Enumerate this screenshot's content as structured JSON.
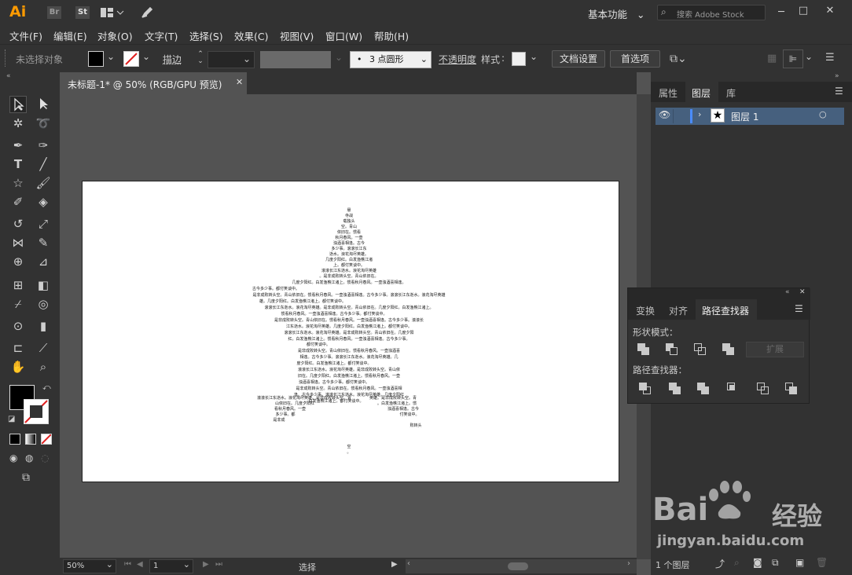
{
  "app": {
    "logo": "Ai",
    "br": "Br",
    "st": "St",
    "workspace": "基本功能",
    "search_placeholder": "搜索 Adobe Stock"
  },
  "menu": [
    "文件(F)",
    "编辑(E)",
    "对象(O)",
    "文字(T)",
    "选择(S)",
    "效果(C)",
    "视图(V)",
    "窗口(W)",
    "帮助(H)"
  ],
  "control": {
    "no_selection": "未选择对象",
    "stroke_label": "描边",
    "brush": "3 点圆形",
    "opacity_label": "不透明度",
    "style_label": "样式",
    "doc_setup": "文档设置",
    "preferences": "首选项"
  },
  "doc": {
    "tab_title": "未标题-1* @ 50% (RGB/GPU 预览)",
    "zoom": "50%",
    "page": "1",
    "status": "选择"
  },
  "layers_panel": {
    "tabs": [
      "属性",
      "图层",
      "库"
    ],
    "layer_name": "图层 1",
    "count": "1 个图层"
  },
  "pathfinder": {
    "tabs": [
      "变换",
      "对齐",
      "路径查找器"
    ],
    "shape_modes": "形状模式：",
    "expand": "扩展",
    "pathfinders": "路径查找器："
  },
  "watermark": {
    "brand": "Bai",
    "brand2": "经验",
    "url": "jingyan.baidu.com"
  },
  "star_text": [
    "悬",
    "寺战",
    "载独头",
    "空。青山",
    "依旧在。惯看",
    "秋月春风。一壶",
    "浊酒喜相逢。古今",
    "多少事。滚滚长江东",
    "逝水。浪花淘尽英雄。",
    "几度夕阳红。白发渔樵江渚",
    "上。都付笑谈中。",
    "滚滚长江东逝水。浪花淘尽英雄",
    "。是非成败转头空。青山依旧在。",
    "几度夕阳红。白发渔樵江渚上。惯看秋月春风。一壶浊酒喜相逢。",
    "古今多少事。都付笑谈中。",
    "是非成败转头空。青山依旧在。惯看秋月春风。一壶浊酒喜相逢。古今多少事。滚滚长江东逝水。浪花淘尽英雄",
    "雄。几度夕阳红。白发渔樵江渚上。都付笑谈中。",
    "滚滚长江东逝水。浪花淘尽英雄。是非成败转头空。青山依旧在。几度夕阳红。白发渔樵江渚上。",
    "惯看秋月春风。一壶浊酒喜相逢。古今多少事。都付笑谈中。",
    "是非成败转头空。青山依旧在。惯看秋月春风。一壶浊酒喜相逢。古今多少事。滚滚长",
    "江东逝水。浪花淘尽英雄。几度夕阳红。白发渔樵江渚上。都付笑谈中。",
    "滚滚长江东逝水。浪花淘尽英雄。是非成败转头空。青山依旧在。几度夕阳",
    "红。白发渔樵江渚上。惯看秋月春风。一壶浊酒喜相逢。古今多少事。",
    "都付笑谈中。",
    "是非成败转头空。青山依旧在。惯看秋月春风。一壶浊酒喜",
    "相逢。古今多少事。滚滚长江东逝水。浪花淘尽英雄。几",
    "度夕阳红。白发渔樵江渚上。都付笑谈中。",
    "滚滚长江东逝水。浪花淘尽英雄。是非成败转头空。青山依",
    "旧在。几度夕阳红。白发渔樵江渚上。惯看秋月春风。一壶",
    "浊酒喜相逢。古今多少事。都付笑谈中。",
    "是非成败转头空。青山依旧在。惯看秋月春风。一壶浊酒喜相",
    "逢。古今多少事。滚滚长江东逝水。浪花淘尽英雄。几度夕阳红",
    "。白发渔樵江渚上。都付笑谈中。",
    "滚滚长江东逝水。浪花淘尽英雄。是非成败转头空。青",
    "英雄。是非成败转头空。青",
    "山依旧在。几度夕阳红",
    "。白发渔樵江渚上。惯",
    "看秋月春风。一壶",
    "浊酒喜相逢。古今",
    "多少事。都",
    "付笑谈中。",
    "是非成",
    "败转头",
    "空",
    "。"
  ]
}
